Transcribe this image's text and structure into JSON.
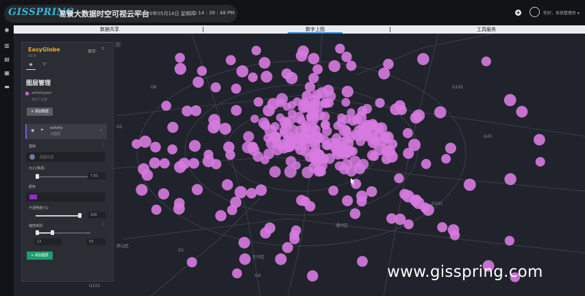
{
  "header": {
    "logo": "GISSPRING",
    "title": "易景大数据时空可视云平台",
    "date": "2020年05月14日 星期四",
    "time": "14 : 39 : 48 PM",
    "user": "你好，系统管理员 ▾"
  },
  "tabs": [
    "数据共享",
    "数字上图",
    "工具服务"
  ],
  "active_tab": 1,
  "sidebar_icons": [
    "eye-icon",
    "building-icon",
    "chart-icon",
    "map-icon",
    "list-icon"
  ],
  "panel": {
    "app_name": "EasyGlobe",
    "version": "V2.0",
    "save_label": "保存",
    "share_icon": "share-icon",
    "heading": "图层管理",
    "data_file": "activity.json",
    "data_sub": "共5个记录",
    "add_data_label": "+ 添加数据",
    "layer": {
      "name": "activity",
      "type": "点图层"
    },
    "sections": {
      "basic": "基础",
      "texture": "贴图纹理",
      "size": "大小(像素)",
      "size_value": "7.61",
      "color": "颜色",
      "opacity": "不透明度(%)",
      "opacity_value": "100",
      "zoom": "缩放级别",
      "zoom_min": "12",
      "zoom_max": "53"
    },
    "add_layer_label": "+ 添加图层"
  },
  "map": {
    "point_color": "#d77ae0",
    "labels": [
      "房山区",
      "大兴区",
      "通州区",
      "G1",
      "G4",
      "G5",
      "G6",
      "G45",
      "G101",
      "G102",
      "G103"
    ]
  },
  "watermark": "www.gisspring.com"
}
